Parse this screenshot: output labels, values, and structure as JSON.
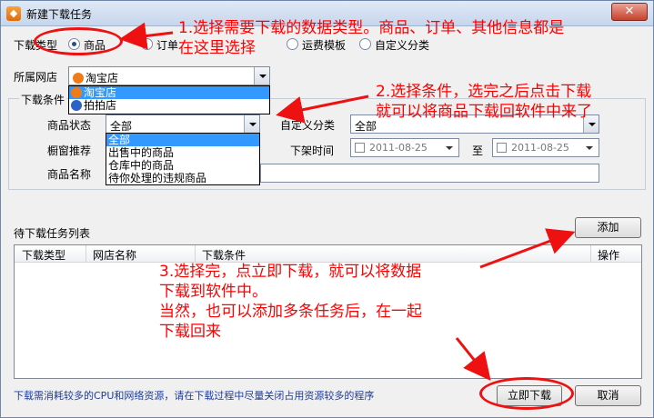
{
  "window": {
    "title": "新建下载任务",
    "app_icon": "taobao-helper-icon",
    "close_glyph": "✕"
  },
  "download_type": {
    "label": "下载类型",
    "options": [
      {
        "label": "商品",
        "checked": true
      },
      {
        "label": "订单",
        "checked": false
      },
      {
        "label": "运费模板",
        "checked": false
      },
      {
        "label": "自定义分类",
        "checked": false
      }
    ]
  },
  "shop": {
    "label": "所属网店",
    "selected": "淘宝店",
    "dropdown": [
      "淘宝店",
      "拍拍店"
    ]
  },
  "conditions": {
    "group_label": "下载条件",
    "product_status": {
      "label": "商品状态",
      "selected": "全部",
      "dropdown": [
        "全部",
        "出售中的商品",
        "仓库中的商品",
        "待你处理的违规商品"
      ]
    },
    "custom_category": {
      "label": "自定义分类",
      "selected": "全部"
    },
    "showcase": {
      "label": "橱窗推荐"
    },
    "delist_time": {
      "label": "下架时间",
      "from": "2011-08-25",
      "to_label": "至",
      "to": "2011-08-25"
    },
    "product_name": {
      "label": "商品名称",
      "value": ""
    }
  },
  "task_list": {
    "label": "待下载任务列表",
    "add_button": "添加",
    "columns": [
      "下载类型",
      "网店名称",
      "下载条件",
      "操作"
    ]
  },
  "footer": {
    "hint": "下载需消耗较多的CPU和网络资源，请在下载过程中尽量关闭占用资源较多的程序",
    "download_now": "立即下载",
    "cancel": "取消"
  },
  "annotations": {
    "note1_line1": "1.选择需要下载的数据类型。商品、订单、其他信息都是",
    "note1_line2": "在这里选择",
    "note2_line1": "2.选择条件，选完之后点击下载",
    "note2_line2": "就可以将商品下载回软件中来了",
    "note3_line1": "3.选择完，点立即下载，就可以将数据",
    "note3_line2": "下载到软件中。",
    "note3_line3": "当然，也可以添加多条任务后，在一起",
    "note3_line4": "下载回来",
    "color": "#ff0000"
  }
}
